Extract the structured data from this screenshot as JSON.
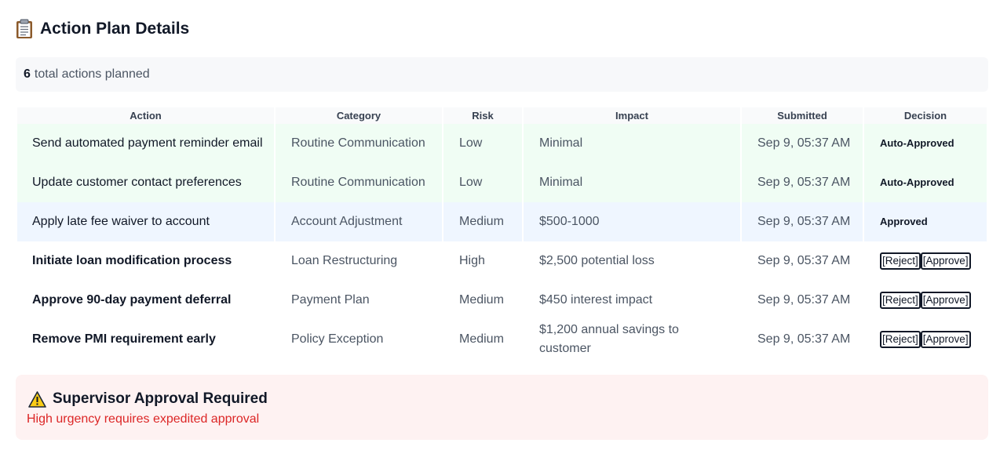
{
  "header": {
    "title": "Action Plan Details",
    "icon": "clipboard-icon"
  },
  "summary": {
    "count": "6",
    "text": "total actions planned"
  },
  "table": {
    "columns": [
      "Action",
      "Category",
      "Risk",
      "Impact",
      "Submitted",
      "Decision"
    ],
    "rows": [
      {
        "action": "Send automated payment reminder email",
        "category": "Routine Communication",
        "risk": "Low",
        "impact": "Minimal",
        "submitted": "Sep 9, 05:37 AM",
        "decision": "Auto-Approved"
      },
      {
        "action": "Update customer contact preferences",
        "category": "Routine Communication",
        "risk": "Low",
        "impact": "Minimal",
        "submitted": "Sep 9, 05:37 AM",
        "decision": "Auto-Approved"
      },
      {
        "action": "Apply late fee waiver to account",
        "category": "Account Adjustment",
        "risk": "Medium",
        "impact": "$500-1000",
        "submitted": "Sep 9, 05:37 AM",
        "decision": "Approved"
      },
      {
        "action": "Initiate loan modification process",
        "category": "Loan Restructuring",
        "risk": "High",
        "impact": "$2,500 potential loss",
        "submitted": "Sep 9, 05:37 AM",
        "reject_label": "[Reject]",
        "approve_label": "[Approve]"
      },
      {
        "action": "Approve 90-day payment deferral",
        "category": "Payment Plan",
        "risk": "Medium",
        "impact": "$450 interest impact",
        "submitted": "Sep 9, 05:37 AM",
        "reject_label": "[Reject]",
        "approve_label": "[Approve]"
      },
      {
        "action": "Remove PMI requirement early",
        "category": "Policy Exception",
        "risk": "Medium",
        "impact": "$1,200 annual savings to customer",
        "submitted": "Sep 9, 05:37 AM",
        "reject_label": "[Reject]",
        "approve_label": "[Approve]"
      }
    ]
  },
  "alert": {
    "icon": "warning-icon",
    "title": "Supervisor Approval Required",
    "message": "High urgency requires expedited approval"
  },
  "colors": {
    "auto_approved_row": "#f0fdf4",
    "approved_row": "#eff6ff",
    "alert_bg": "#fef2f2",
    "alert_text": "#dc2626"
  }
}
